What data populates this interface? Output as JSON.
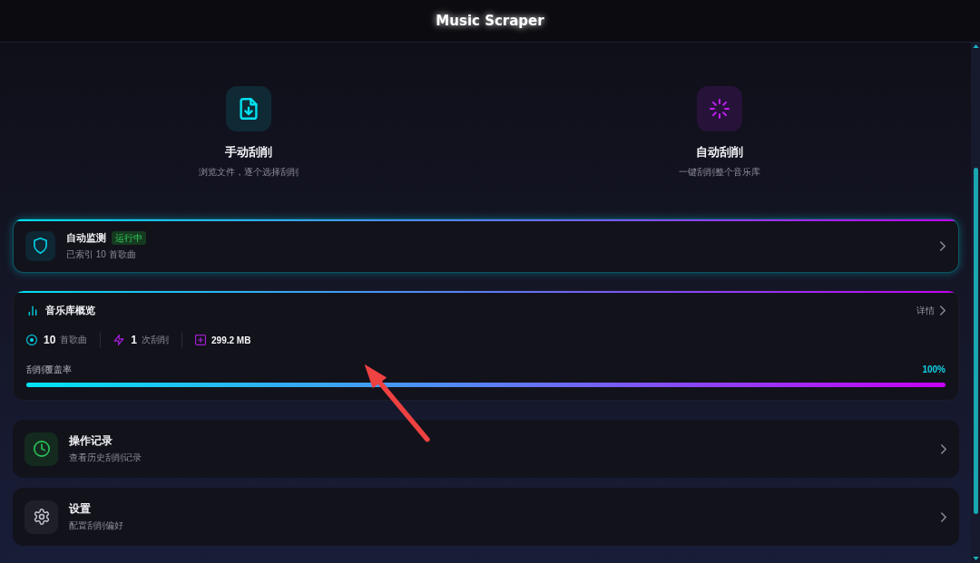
{
  "header": {
    "title": "Music Scraper"
  },
  "modes": [
    {
      "kind": "manual",
      "title": "手动刮削",
      "subtitle": "浏览文件，逐个选择刮削"
    },
    {
      "kind": "auto",
      "title": "自动刮削",
      "subtitle": "一键刮削整个音乐库"
    }
  ],
  "monitor": {
    "title": "自动监测",
    "status": "运行中",
    "subtitle": "已索引 10 首歌曲"
  },
  "overview": {
    "title": "音乐库概览",
    "details_link": "详情",
    "stats": [
      {
        "kind": "songs",
        "value": "10",
        "unit": "首歌曲"
      },
      {
        "kind": "scrapes",
        "value": "1",
        "unit": "次刮削"
      },
      {
        "kind": "size",
        "value": "299.2 MB"
      }
    ],
    "coverage": {
      "label": "刮削覆盖率",
      "reading": "100%",
      "level": 1
    }
  },
  "menu": [
    {
      "kind": "history",
      "title": "操作记录",
      "subtitle": "查看历史刮削记录"
    },
    {
      "kind": "settings",
      "title": "设置",
      "subtitle": "配置刮削偏好"
    }
  ]
}
